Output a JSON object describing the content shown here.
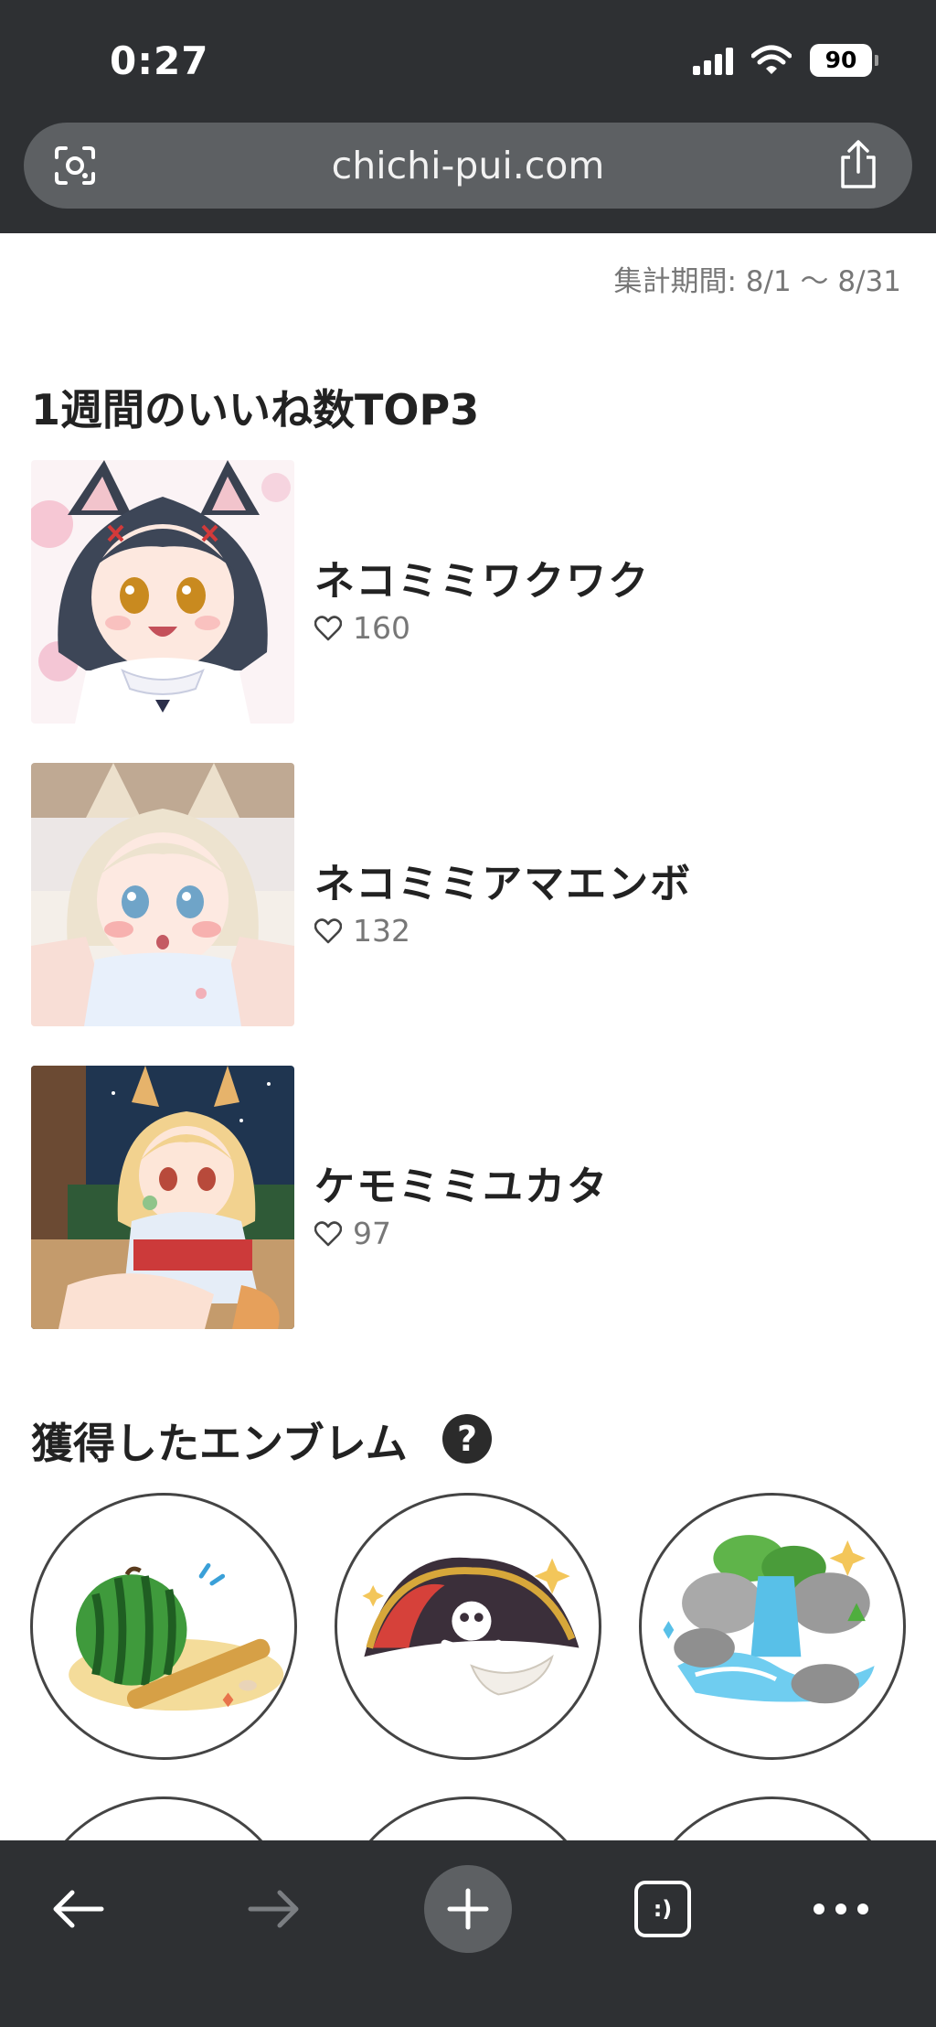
{
  "status_bar": {
    "time": "0:27",
    "battery": "90"
  },
  "browser": {
    "url": "chichi-pui.com"
  },
  "page": {
    "period_label": "集計期間: 8/1 〜 8/31",
    "top3_title": "1週間のいいね数TOP3",
    "ranking": [
      {
        "title": "ネコミミワクワク",
        "likes": "160"
      },
      {
        "title": "ネコミミアマエンボ",
        "likes": "132"
      },
      {
        "title": "ケモミミユカタ",
        "likes": "97"
      }
    ],
    "emblems_title": "獲得したエンブレム",
    "help_glyph": "?",
    "emblems": [
      {
        "icon": "watermelon-icon"
      },
      {
        "icon": "pirate-hat-icon"
      },
      {
        "icon": "waterfall-icon"
      }
    ]
  },
  "toolbar": {
    "tabs_glyph": ":)"
  },
  "colors": {
    "chrome": "#2e3033",
    "url_bar": "#5d6063",
    "text_dark": "#222222",
    "text_muted": "#777777"
  }
}
